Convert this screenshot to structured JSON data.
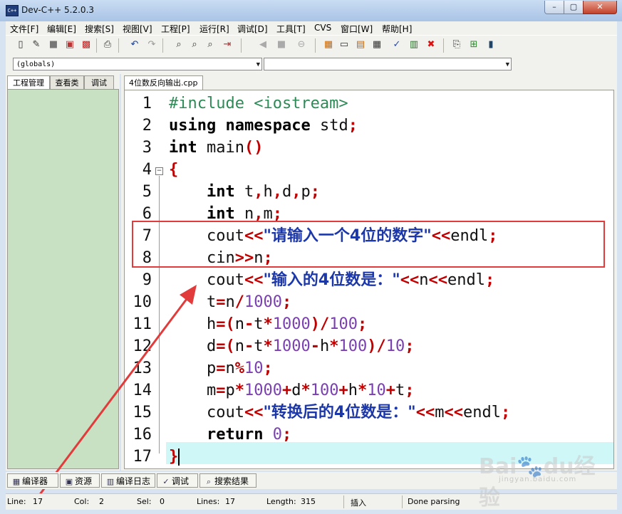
{
  "window": {
    "title": "Dev-C++ 5.2.0.3",
    "min": "–",
    "max": "▢",
    "close": "✕"
  },
  "menu": [
    "文件[F]",
    "编辑[E]",
    "搜索[S]",
    "视图[V]",
    "工程[P]",
    "运行[R]",
    "调试[D]",
    "工具[T]",
    "CVS",
    "窗口[W]",
    "帮助[H]"
  ],
  "toolbar_icons": [
    "new-icon",
    "open-icon",
    "save-icon",
    "save-all-icon",
    "close-file-icon",
    "print-icon",
    "undo-icon",
    "redo-icon",
    "find-icon",
    "replace-icon",
    "find-next-icon",
    "goto-line-icon",
    "add-bookmark-icon",
    "goto-bookmark-icon",
    "stop-icon",
    "compile-icon",
    "run-icon",
    "compile-run-icon",
    "rebuild-icon",
    "check-icon",
    "chart-icon",
    "delete-icon",
    "insert-icon",
    "new-class-icon",
    "bookmark-icon"
  ],
  "combos": {
    "scope": "(globals)",
    "members": ""
  },
  "left_tabs": [
    "工程管理",
    "查看类",
    "调试"
  ],
  "file_tab": "4位数反向输出.cpp",
  "line_numbers": [
    "1",
    "2",
    "3",
    "4",
    "5",
    "6",
    "7",
    "8",
    "9",
    "10",
    "11",
    "12",
    "13",
    "14",
    "15",
    "16",
    "17"
  ],
  "code": {
    "l1": "#include <iostream>",
    "l2_kw1": "using",
    "l2_kw2": "namespace",
    "l2_rest": " std",
    "l2_semi": ";",
    "l3_kw": "int",
    "l3_rest": " main",
    "l3_paren": "()",
    "l4": "{",
    "l5_kw": "int",
    "l5_a": " t",
    "l5_b": "h",
    "l5_c": "d",
    "l5_d": "p",
    "l6_kw": "int",
    "l6_a": " n",
    "l6_b": "m",
    "l7_a": "cout",
    "l7_op": "<<",
    "l7_str": "\"请输入一个4位的数字\"",
    "l7_op2": "<<",
    "l7_b": "endl",
    "l7_semi": ";",
    "l8_a": "cin",
    "l8_op": ">>",
    "l8_b": "n",
    "l8_semi": ";",
    "l9_a": "cout",
    "l9_op": "<<",
    "l9_str": "\"输入的4位数是：\"",
    "l9_op2": "<<",
    "l9_b": "n",
    "l9_op3": "<<",
    "l9_c": "endl",
    "l9_semi": ";",
    "l10_a": "t",
    "l10_eq": "=",
    "l10_b": "n",
    "l10_div": "/",
    "l10_num": "1000",
    "l10_semi": ";",
    "l11": "h=(n-t*1000)/100;",
    "l12": "d=(n-t*1000-h*100)/10;",
    "l13": "p=n%10;",
    "l14": "m=p*1000+d*100+h*10+t;",
    "l15_a": "cout",
    "l15_op": "<<",
    "l15_str": "\"转换后的4位数是：\"",
    "l15_op2": "<<",
    "l15_b": "m",
    "l15_op3": "<<",
    "l15_c": "endl",
    "l15_semi": ";",
    "l16_kw": "return",
    "l16_num": " 0",
    "l16_semi": ";",
    "l17": "}"
  },
  "bottom_tabs": [
    {
      "label": "编译器",
      "icon": "compiler-icon"
    },
    {
      "label": "资源",
      "icon": "resources-icon"
    },
    {
      "label": "编译日志",
      "icon": "compile-log-icon"
    },
    {
      "label": "调试",
      "icon": "debug-icon"
    },
    {
      "label": "搜索结果",
      "icon": "search-results-icon"
    }
  ],
  "status": {
    "line_label": "Line:",
    "line": "17",
    "col_label": "Col:",
    "col": "2",
    "sel_label": "Sel:",
    "sel": "0",
    "lines_label": "Lines:",
    "lines": "17",
    "length_label": "Length:",
    "length": "315",
    "mode": "插入",
    "message": "Done parsing"
  },
  "watermark": {
    "brand": "Bai",
    "paw": "du",
    "cn": "经验",
    "sub": "jingyan.baidu.com"
  },
  "colors": {
    "keyword": "#000000",
    "operator": "#c00000",
    "number": "#7a3fb0",
    "string": "#1c37a8",
    "annotation": "#e23b3b",
    "current_line": "#cff7f7"
  }
}
